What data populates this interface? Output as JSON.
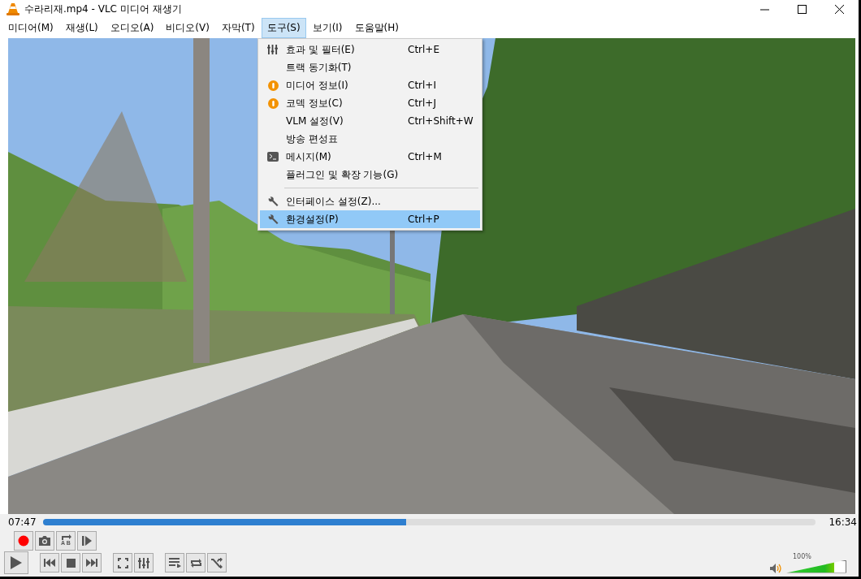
{
  "window": {
    "title": "수라리재.mp4 - VLC 미디어 재생기"
  },
  "menu_bar": [
    {
      "label": "미디어(M)",
      "selected": false
    },
    {
      "label": "재생(L)",
      "selected": false
    },
    {
      "label": "오디오(A)",
      "selected": false
    },
    {
      "label": "비디오(V)",
      "selected": false
    },
    {
      "label": "자막(T)",
      "selected": false
    },
    {
      "label": "도구(S)",
      "selected": true
    },
    {
      "label": "보기(I)",
      "selected": false
    },
    {
      "label": "도움말(H)",
      "selected": false
    }
  ],
  "dropdown": [
    {
      "kind": "sliders",
      "label": "효과 및 필터(E)",
      "shortcut": "Ctrl+E",
      "selected": false
    },
    {
      "kind": "plain",
      "label": "트랙 동기화(T)",
      "selected": false
    },
    {
      "kind": "info",
      "label": "미디어 정보(I)",
      "shortcut": "Ctrl+I",
      "selected": false
    },
    {
      "kind": "info",
      "label": "코덱 정보(C)",
      "shortcut": "Ctrl+J",
      "selected": false
    },
    {
      "kind": "plain",
      "label": "VLM 설정(V)",
      "shortcut": "Ctrl+Shift+W",
      "selected": false
    },
    {
      "kind": "plain",
      "label": "방송 편성표",
      "selected": false
    },
    {
      "kind": "console",
      "label": "메시지(M)",
      "shortcut": "Ctrl+M",
      "selected": false
    },
    {
      "kind": "plain",
      "label": "플러그인 및 확장 기능(G)",
      "selected": false
    },
    {
      "kind": "separator"
    },
    {
      "kind": "wrench",
      "label": "인터페이스 설정(Z)...",
      "selected": false
    },
    {
      "kind": "wrench",
      "label": "환경설정(P)",
      "shortcut": "Ctrl+P",
      "selected": true
    }
  ],
  "seek": {
    "elapsed": "07:47",
    "total": "16:34",
    "level": 0.47
  },
  "ab_label": "A B",
  "volume": {
    "reading": "100%",
    "level": 0.8
  }
}
